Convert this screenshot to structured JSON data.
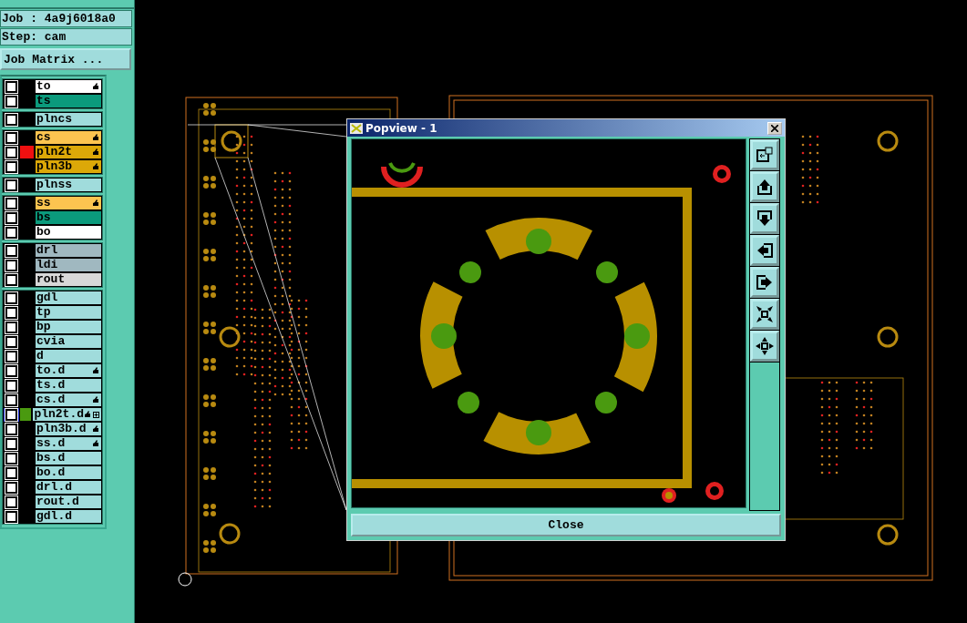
{
  "job": {
    "label": "Job : 4a9j6018a0",
    "step": "Step: cam",
    "matrix_button": "Job Matrix ..."
  },
  "layer_groups": [
    {
      "layers": [
        {
          "name": "to",
          "color": "#ffffff",
          "pen": true,
          "active": false,
          "extra": false
        },
        {
          "name": "ts",
          "color": "#0b9a7c",
          "pen": false,
          "active": false,
          "extra": false
        }
      ]
    },
    {
      "layers": [
        {
          "name": "plncs",
          "color": "#a0dcdc",
          "pen": false,
          "active": false,
          "extra": false
        }
      ]
    },
    {
      "layers": [
        {
          "name": "cs",
          "color": "#fcc450",
          "pen": true,
          "active": false,
          "extra": false
        },
        {
          "name": "pln2t",
          "color": "#dca808",
          "pen": true,
          "swatch": {
            "color": "#f01010"
          },
          "active": false,
          "extra": false
        },
        {
          "name": "pln3b",
          "color": "#dca808",
          "pen": true,
          "active": false,
          "extra": false
        }
      ]
    },
    {
      "layers": [
        {
          "name": "plnss",
          "color": "#a0dcdc",
          "pen": false,
          "active": false,
          "extra": false
        }
      ]
    },
    {
      "layers": [
        {
          "name": "ss",
          "color": "#fcc450",
          "pen": true,
          "active": false,
          "extra": false
        },
        {
          "name": "bs",
          "color": "#0b9a7c",
          "pen": false,
          "active": false,
          "extra": false
        },
        {
          "name": "bo",
          "color": "#ffffff",
          "pen": false,
          "active": false,
          "extra": false
        }
      ]
    },
    {
      "layers": [
        {
          "name": "drl",
          "color": "#a0b8c0",
          "pen": false,
          "active": false,
          "extra": false
        },
        {
          "name": "ldi",
          "color": "#a0b8c0",
          "pen": false,
          "active": false,
          "extra": false
        },
        {
          "name": "rout",
          "color": "#d8d8d8",
          "pen": false,
          "active": false,
          "extra": false
        }
      ]
    },
    {
      "layers": [
        {
          "name": "gdl",
          "color": "#a0dcdc",
          "pen": false,
          "active": false,
          "extra": false
        },
        {
          "name": "tp",
          "color": "#a0dcdc",
          "pen": false,
          "active": false,
          "extra": false
        },
        {
          "name": "bp",
          "color": "#a0dcdc",
          "pen": false,
          "active": false,
          "extra": false
        },
        {
          "name": "cvia",
          "color": "#a0dcdc",
          "pen": false,
          "active": false,
          "extra": false
        },
        {
          "name": "d",
          "color": "#a0dcdc",
          "pen": false,
          "active": false,
          "extra": false
        },
        {
          "name": "to.d",
          "color": "#a0dcdc",
          "pen": true,
          "active": false,
          "extra": false
        },
        {
          "name": "ts.d",
          "color": "#a0dcdc",
          "pen": false,
          "active": false,
          "extra": false
        },
        {
          "name": "cs.d",
          "color": "#a0dcdc",
          "pen": true,
          "active": false,
          "extra": false
        },
        {
          "name": "pln2t.d",
          "color": "#a0dcdc",
          "pen": true,
          "swatch": {
            "color": "#4a9a10"
          },
          "active": true,
          "extra": true
        },
        {
          "name": "pln3b.d",
          "color": "#a0dcdc",
          "pen": true,
          "active": false,
          "extra": false
        },
        {
          "name": "ss.d",
          "color": "#a0dcdc",
          "pen": true,
          "active": false,
          "extra": false
        },
        {
          "name": "bs.d",
          "color": "#a0dcdc",
          "pen": false,
          "active": false,
          "extra": false
        },
        {
          "name": "bo.d",
          "color": "#a0dcdc",
          "pen": false,
          "active": false,
          "extra": false
        },
        {
          "name": "drl.d",
          "color": "#a0dcdc",
          "pen": false,
          "active": false,
          "extra": false
        },
        {
          "name": "rout.d",
          "color": "#a0dcdc",
          "pen": false,
          "active": false,
          "extra": false
        },
        {
          "name": "gdl.d",
          "color": "#a0dcdc",
          "pen": false,
          "active": false,
          "extra": false
        }
      ]
    }
  ],
  "popview": {
    "title": "Popview - 1",
    "tools": [
      {
        "kind": "zoom-back"
      },
      {
        "kind": "pan-up"
      },
      {
        "kind": "pan-down"
      },
      {
        "kind": "pan-left"
      },
      {
        "kind": "pan-right"
      },
      {
        "kind": "zoom-in"
      },
      {
        "kind": "zoom-out"
      }
    ],
    "close_button": "Close"
  }
}
